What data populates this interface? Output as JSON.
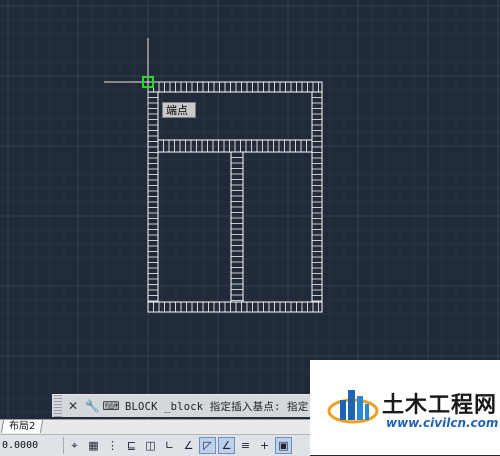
{
  "canvas": {
    "background": "#212a38",
    "grid_color": "#2e3848",
    "drawing_color": "#ffffff",
    "snap_color": "#22dd22"
  },
  "snap_tooltip": {
    "text": "端点"
  },
  "command_line": {
    "close_icon": "close-icon",
    "settings_icon": "wrench-icon",
    "prompt_icon": "command-prompt-icon",
    "text": "BLOCK _block 指定插入基点: 指定"
  },
  "layout_tabs": {
    "active_tab": "布局2"
  },
  "status_bar": {
    "coordinates": "0.0000",
    "buttons": [
      {
        "icon": "model-space-icon",
        "glyph": "⌖",
        "on": false
      },
      {
        "icon": "grid-display-icon",
        "glyph": "▦",
        "on": false
      },
      {
        "icon": "snap-mode-icon",
        "glyph": "⋮",
        "on": false
      },
      {
        "icon": "infer-constraints-icon",
        "glyph": "⊑",
        "on": false
      },
      {
        "icon": "dynamic-input-icon",
        "glyph": "◫",
        "on": false
      },
      {
        "icon": "ortho-mode-icon",
        "glyph": "∟",
        "on": false
      },
      {
        "icon": "polar-tracking-icon",
        "glyph": "∠",
        "on": false
      },
      {
        "icon": "object-snap-icon",
        "glyph": "◸",
        "on": true
      },
      {
        "icon": "object-snap-tracking-icon",
        "glyph": "∠",
        "on": true
      },
      {
        "icon": "lineweight-icon",
        "glyph": "≡",
        "on": false
      },
      {
        "icon": "transparency-icon",
        "glyph": "+",
        "on": false
      },
      {
        "icon": "quick-properties-icon",
        "glyph": "▣",
        "on": true
      }
    ]
  },
  "watermark": {
    "title": "土木工程网",
    "url": "www.civilcn.com"
  }
}
